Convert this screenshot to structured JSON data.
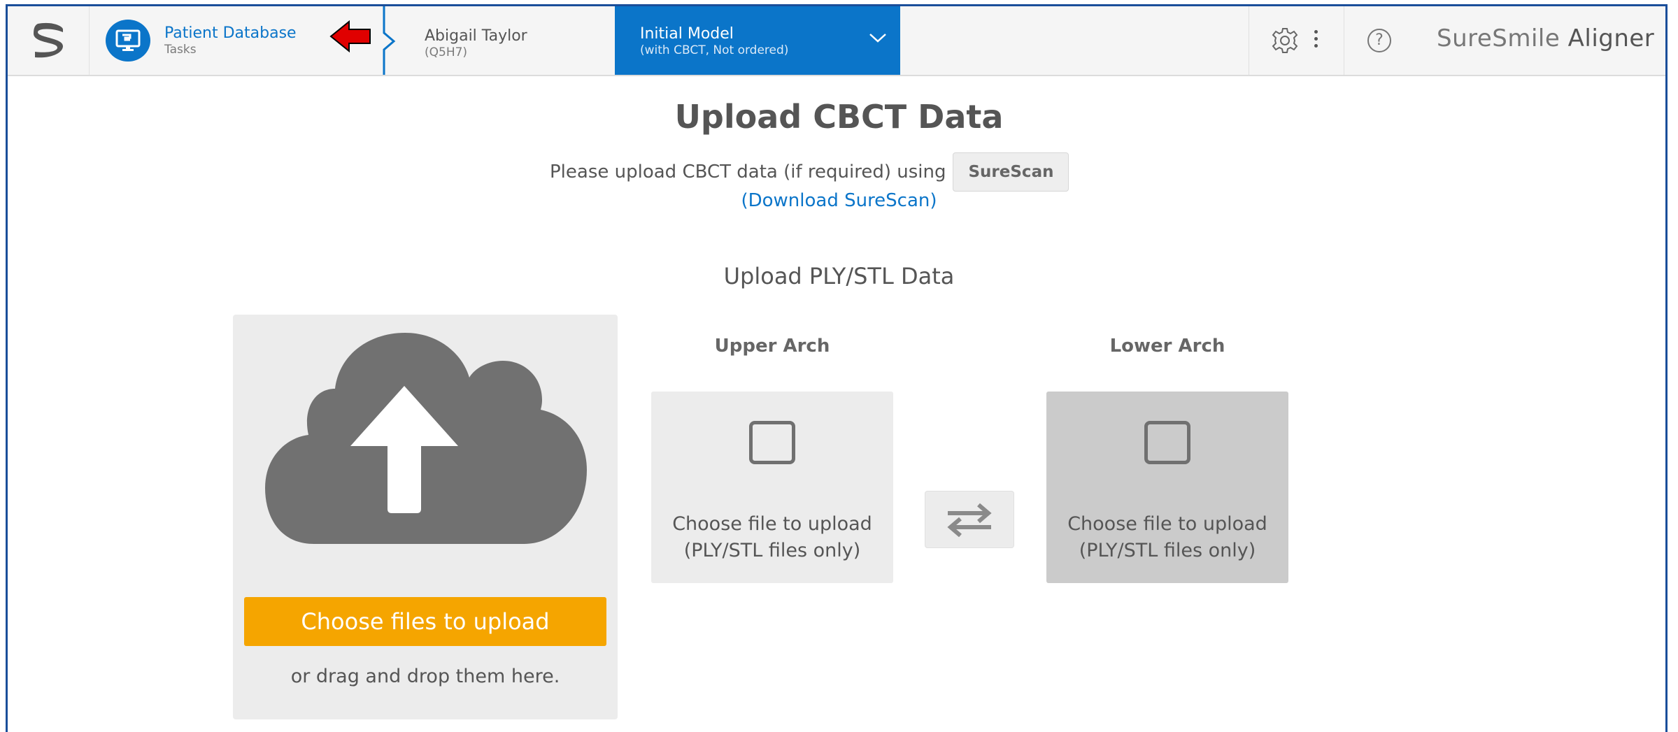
{
  "header": {
    "logo_icon": "suresmile-logo-icon",
    "patient_db": {
      "title": "Patient Database",
      "subtitle": "Tasks",
      "icon": "monitor-icon"
    },
    "patient": {
      "name": "Abigail Taylor",
      "id": "(Q5H7)"
    },
    "model_tab": {
      "title": "Initial Model",
      "subtitle": "(with CBCT, Not ordered)"
    },
    "brand": {
      "part1": "SureSmile",
      "part2": "Aligner"
    },
    "help_symbol": "?"
  },
  "main": {
    "title": "Upload CBCT Data",
    "cbct_prompt": "Please upload CBCT data (if required) using",
    "surescan_button": "SureScan",
    "download_link": "(Download SureScan)",
    "ply_title": "Upload PLY/STL Data",
    "drop_zone": {
      "button": "Choose files to upload",
      "hint": "or drag and drop them here."
    },
    "upper_arch": {
      "label": "Upper Arch",
      "line1": "Choose file to upload",
      "line2": "(PLY/STL files only)"
    },
    "lower_arch": {
      "label": "Lower Arch",
      "line1": "Choose file to upload",
      "line2": "(PLY/STL files only)"
    }
  },
  "colors": {
    "accent_blue": "#0b75c9",
    "upload_orange": "#f5a500",
    "annotation_red": "#e00000"
  }
}
